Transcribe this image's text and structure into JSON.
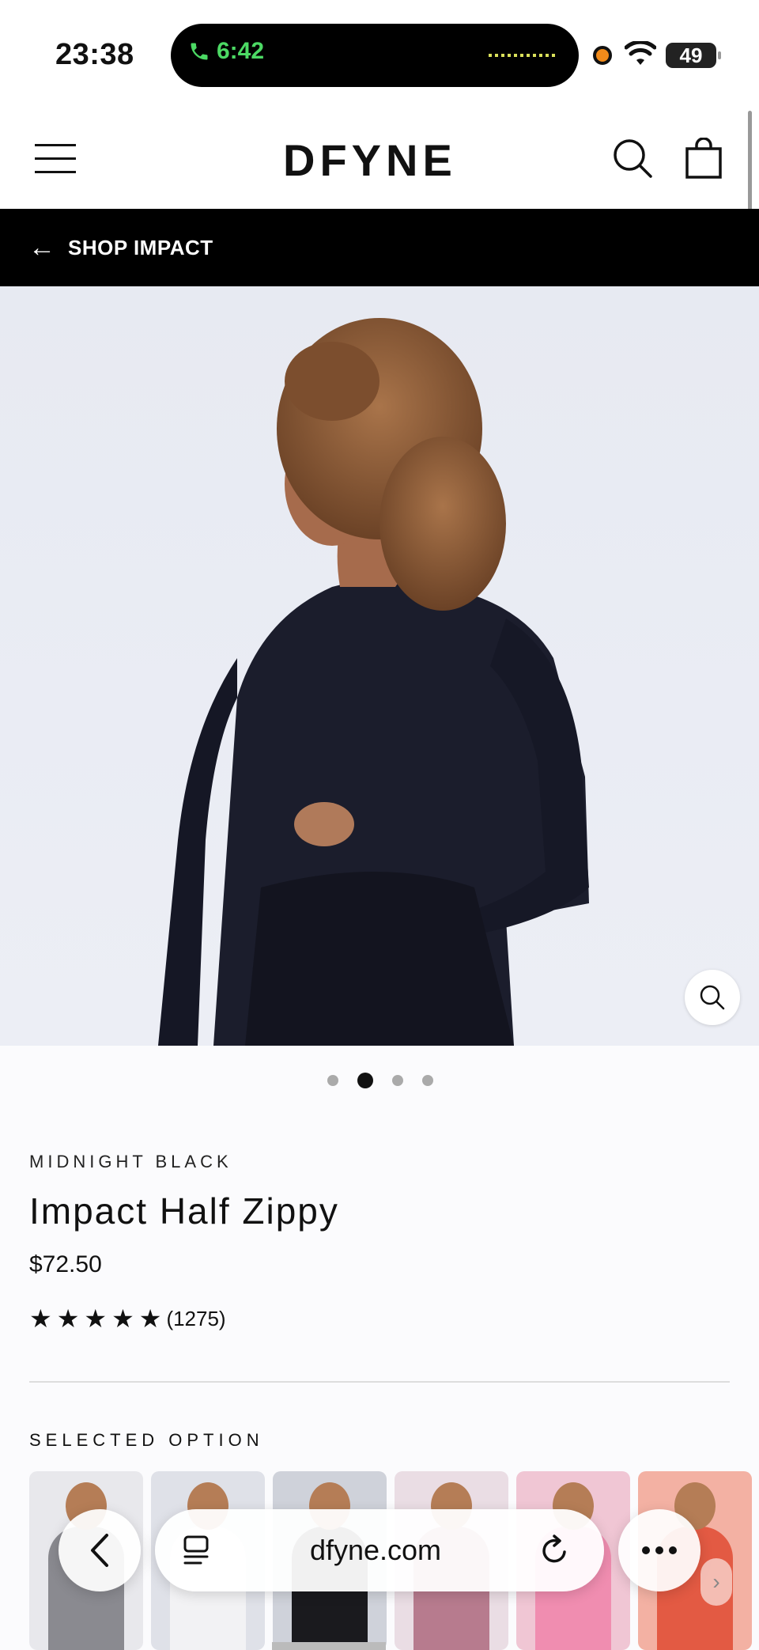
{
  "status_bar": {
    "time": "23:38",
    "call_time": "6:42",
    "battery": "49"
  },
  "header": {
    "logo": "DFYNE",
    "menu_icon": "hamburger-icon",
    "search_icon": "search-icon",
    "cart_icon": "bag-icon"
  },
  "shop_bar": {
    "label": "SHOP IMPACT"
  },
  "gallery": {
    "image_count": 4,
    "active_index": 1
  },
  "product": {
    "variant": "MIDNIGHT BLACK",
    "title": "Impact Half Zippy",
    "price": "$72.50",
    "stars": 5,
    "review_count": "(1275)"
  },
  "options": {
    "heading": "SELECTED OPTION",
    "swatch_colors": [
      "#e8e8ec",
      "#dfe1e8",
      "#cfd2da",
      "#eadde4",
      "#f0c6d4",
      "#f3b1a3"
    ],
    "swatch_body_colors": [
      "#8a8a90",
      "#f2f2f4",
      "#1a1a1e",
      "#b77b8e",
      "#f08db0",
      "#e35a43"
    ]
  },
  "browser": {
    "url": "dfyne.com"
  },
  "colors": {
    "accent": "#000000",
    "call_green": "#4cd964"
  }
}
